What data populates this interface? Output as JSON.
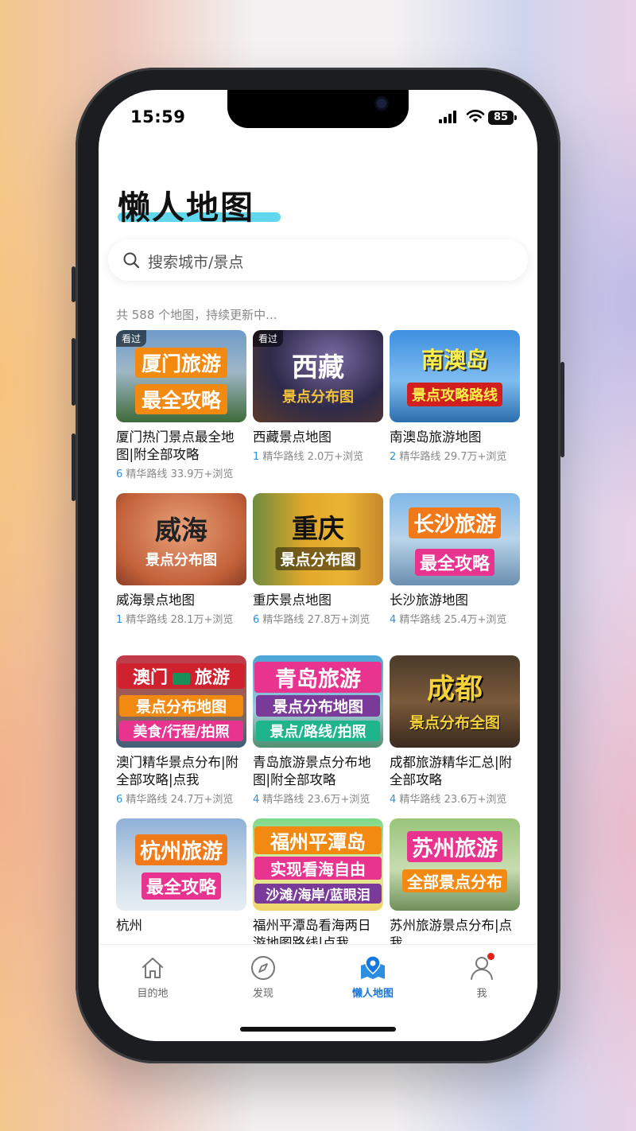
{
  "status": {
    "time": "15:59",
    "battery": "85"
  },
  "header": {
    "title": "懒人地图"
  },
  "search": {
    "placeholder": "搜索城市/景点"
  },
  "summary": "共 588 个地图，持续更新中...",
  "seen_label": "看过",
  "cards": [
    {
      "title": "厦门热门景点最全地图|附全部攻略",
      "routes": "6",
      "routes_label": "精华路线",
      "views": "33.9万+浏览",
      "seen": true,
      "overlay": [
        "厦门旅游",
        "最全攻略"
      ]
    },
    {
      "title": "西藏景点地图",
      "routes": "1",
      "routes_label": "精华路线",
      "views": "2.0万+浏览",
      "seen": true,
      "overlay": [
        "西藏",
        "景点分布图"
      ]
    },
    {
      "title": "南澳岛旅游地图",
      "routes": "2",
      "routes_label": "精华路线",
      "views": "29.7万+浏览",
      "seen": false,
      "overlay": [
        "南澳岛",
        "景点攻略路线"
      ]
    },
    {
      "title": "威海景点地图",
      "routes": "1",
      "routes_label": "精华路线",
      "views": "28.1万+浏览",
      "seen": false,
      "overlay": [
        "威海",
        "景点分布图"
      ]
    },
    {
      "title": "重庆景点地图",
      "routes": "6",
      "routes_label": "精华路线",
      "views": "27.8万+浏览",
      "seen": false,
      "overlay": [
        "重庆",
        "景点分布图"
      ]
    },
    {
      "title": "长沙旅游地图",
      "routes": "4",
      "routes_label": "精华路线",
      "views": "25.4万+浏览",
      "seen": false,
      "overlay": [
        "长沙旅游",
        "最全攻略"
      ]
    },
    {
      "title": "澳门精华景点分布|附全部攻略|点我",
      "routes": "6",
      "routes_label": "精华路线",
      "views": "24.7万+浏览",
      "seen": false,
      "overlay": [
        "澳门",
        "旅游",
        "景点分布地图",
        "美食/行程/拍照"
      ]
    },
    {
      "title": "青岛旅游景点分布地图|附全部攻略",
      "routes": "4",
      "routes_label": "精华路线",
      "views": "23.6万+浏览",
      "seen": false,
      "overlay": [
        "青岛旅游",
        "景点分布地图",
        "景点/路线/拍照"
      ]
    },
    {
      "title": "成都旅游精华汇总|附全部攻略",
      "routes": "4",
      "routes_label": "精华路线",
      "views": "23.6万+浏览",
      "seen": false,
      "overlay": [
        "成都",
        "景点分布全图"
      ]
    },
    {
      "title": "杭州",
      "routes": "",
      "routes_label": "",
      "views": "",
      "seen": false,
      "overlay": [
        "杭州旅游",
        "最全攻略"
      ]
    },
    {
      "title": "福州平潭岛看海两日游地图路线|点我",
      "routes": "",
      "routes_label": "",
      "views": "",
      "seen": false,
      "overlay": [
        "福州平潭岛",
        "实现看海自由",
        "沙滩/海岸/蓝眼泪"
      ]
    },
    {
      "title": "苏州旅游景点分布|点我",
      "routes": "",
      "routes_label": "",
      "views": "",
      "seen": false,
      "overlay": [
        "苏州旅游",
        "全部景点分布"
      ]
    }
  ],
  "tabs": [
    {
      "label": "目的地",
      "icon": "home-icon"
    },
    {
      "label": "发现",
      "icon": "compass-icon"
    },
    {
      "label": "懒人地图",
      "icon": "map-pin-icon"
    },
    {
      "label": "我",
      "icon": "user-icon"
    }
  ]
}
